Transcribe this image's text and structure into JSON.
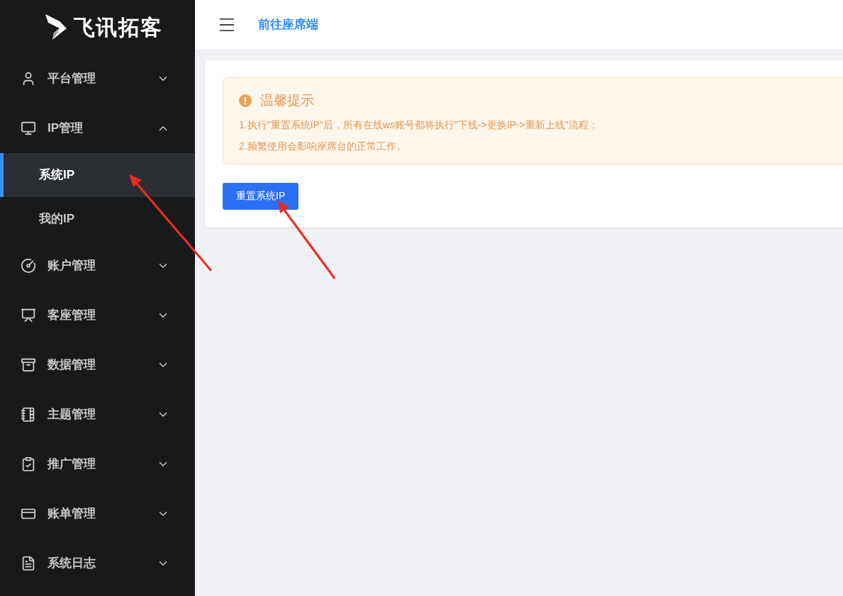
{
  "logo": {
    "text": "飞讯拓客"
  },
  "sidebar": {
    "items": [
      {
        "label": "平台管理",
        "expanded": false
      },
      {
        "label": "IP管理",
        "expanded": true,
        "children": [
          {
            "label": "系统IP",
            "selected": true
          },
          {
            "label": "我的IP",
            "selected": false
          }
        ]
      },
      {
        "label": "账户管理",
        "expanded": false
      },
      {
        "label": "客座管理",
        "expanded": false
      },
      {
        "label": "数据管理",
        "expanded": false
      },
      {
        "label": "主题管理",
        "expanded": false
      },
      {
        "label": "推广管理",
        "expanded": false
      },
      {
        "label": "账单管理",
        "expanded": false
      },
      {
        "label": "系统日志",
        "expanded": false
      }
    ]
  },
  "header": {
    "link": "前往座席端"
  },
  "alert": {
    "title": "温馨提示",
    "lines": [
      "1.执行\"重置系统IP\"后，所有在线ws账号都将执行\"下线->更换IP->重新上线\"流程；",
      "2.频繁使用会影响座席台的正常工作。"
    ]
  },
  "button": "重置系统IP"
}
